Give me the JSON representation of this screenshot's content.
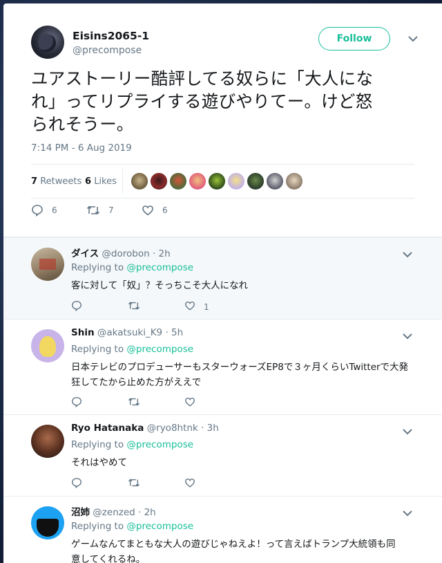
{
  "tweet": {
    "display_name": "Eisins2065-1",
    "handle": "@precompose",
    "follow_label": "Follow",
    "text": "ユアストーリー酷評してる奴らに「大人にな\nれ」ってリプライする遊びやりてー。けど怒\nられそうー。",
    "timestamp": "7:14 PM - 6 Aug 2019",
    "retweets_count": "7",
    "retweets_label": "Retweets",
    "likes_count": "6",
    "likes_label": "Likes",
    "actions": {
      "reply_count": "6",
      "retweet_count": "7",
      "like_count": "6"
    }
  },
  "replies": [
    {
      "name": "ダイス",
      "handle": "@dorobon",
      "time": "· 2h",
      "replying_label": "Replying to",
      "mention": "@precompose",
      "text": "客に対して「奴」？そっちこそ大人になれ",
      "like_count": "1"
    },
    {
      "name": "Shin",
      "handle": "@akatsuki_K9",
      "time": "· 5h",
      "replying_label": "Replying to",
      "mention": "@precompose",
      "text": "日本テレビのプロデューサーもスターウォーズEP8で３ヶ月くらいTwitterで大発\n狂してたから止めた方がええで",
      "like_count": ""
    },
    {
      "name": "Ryo Hatanaka",
      "handle": "@ryo8htnk",
      "time": "· 3h",
      "replying_label": "Replying to",
      "mention": "@precompose",
      "text": "それはやめて",
      "like_count": ""
    },
    {
      "name": "沼姉",
      "handle": "@zenzed",
      "time": "· 2h",
      "replying_label": "Replying to",
      "mention": "@precompose",
      "text": "ゲームなんてまともな大人の遊びじゃねえよ！って言えばトランプ大統領も同\n意してくれるね。",
      "like_count": ""
    }
  ],
  "colors": {
    "accent": "#17bf9a",
    "muted": "#657786",
    "text": "#14171a",
    "divider": "#e6ecf0",
    "highlight_bg": "#f5f8fa"
  }
}
